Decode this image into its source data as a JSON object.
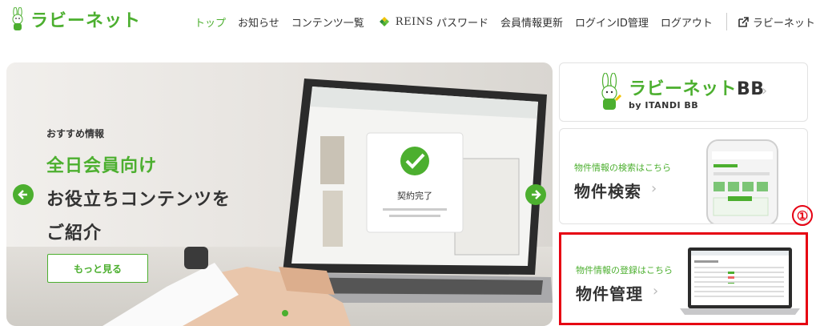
{
  "header": {
    "logo_text": "ラビーネット",
    "nav": [
      {
        "label": "トップ"
      },
      {
        "label": "お知らせ"
      },
      {
        "label": "コンテンツ一覧"
      },
      {
        "label": "パスワード",
        "brand": "REINS"
      },
      {
        "label": "会員情報更新"
      },
      {
        "label": "ログインID管理"
      },
      {
        "label": "ログアウト"
      }
    ],
    "external_link": "ラビーネットBB"
  },
  "hero": {
    "kicker": "おすすめ情報",
    "line1": "全日会員向け",
    "line2": "お役立ちコンテンツを",
    "line3": "ご紹介",
    "more_label": "もっと見る",
    "dialog_text": "契約完了"
  },
  "cards": {
    "bb": {
      "title_green": "ラビーネット",
      "title_dark": "BB",
      "by": "by ITANDI BB"
    },
    "search": {
      "sub": "物件情報の検索はこちら",
      "main": "物件検索"
    },
    "manage": {
      "sub": "物件情報の登録はこちら",
      "main": "物件管理"
    }
  },
  "annotation": {
    "marker": "①"
  },
  "colors": {
    "accent": "#4caf2f",
    "highlight": "#e60012"
  }
}
